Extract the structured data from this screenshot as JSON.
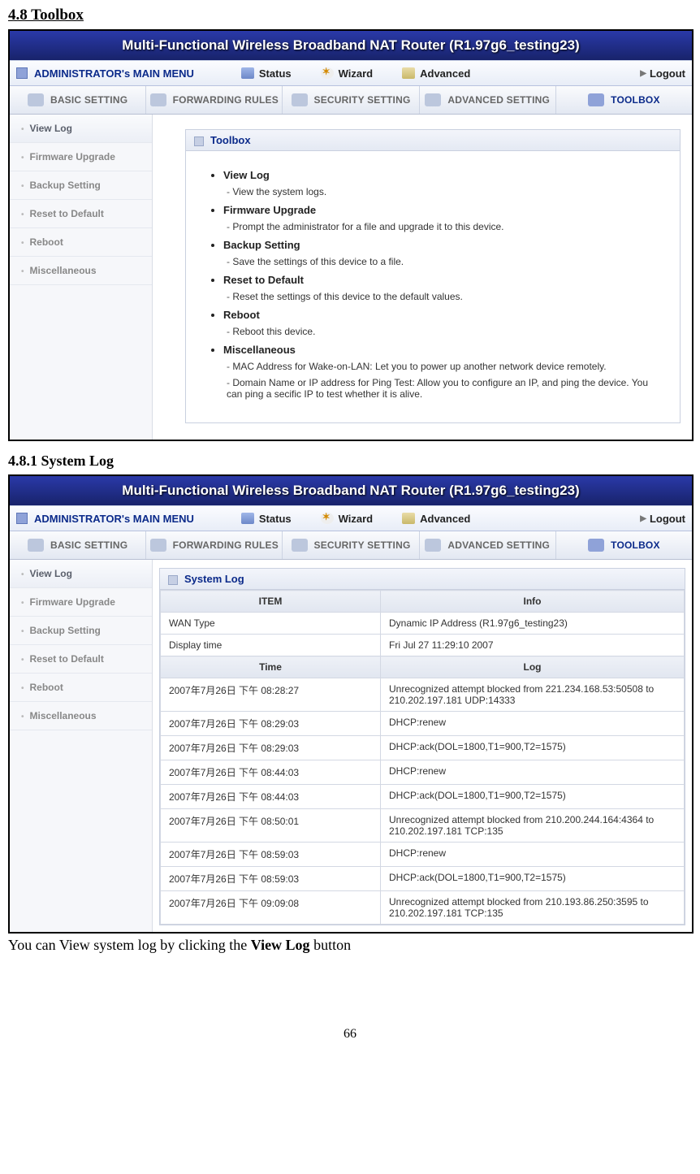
{
  "doc": {
    "section_heading": "4.8 Toolbox",
    "sub_heading": "4.8.1 System Log",
    "caption_pre": "You can View system log by clicking the ",
    "caption_bold": "View Log",
    "caption_post": " button",
    "page_number": "66"
  },
  "router": {
    "title": "Multi-Functional Wireless Broadband NAT Router (R1.97g6_testing23)",
    "main_menu_label": "ADMINISTRATOR's MAIN MENU",
    "menu": {
      "status": "Status",
      "wizard": "Wizard",
      "advanced": "Advanced",
      "logout": "Logout"
    },
    "tabs": {
      "basic": "BASIC SETTING",
      "forwarding": "FORWARDING RULES",
      "security": "SECURITY SETTING",
      "advanced": "ADVANCED SETTING",
      "toolbox": "TOOLBOX"
    },
    "sidebar": {
      "view_log": "View Log",
      "firmware": "Firmware Upgrade",
      "backup": "Backup Setting",
      "reset": "Reset to Default",
      "reboot": "Reboot",
      "misc": "Miscellaneous"
    }
  },
  "toolbox_panel": {
    "header": "Toolbox",
    "items": {
      "view_log": {
        "title": "View Log",
        "desc": "View the system logs."
      },
      "firmware": {
        "title": "Firmware Upgrade",
        "desc": "Prompt the administrator for a file and upgrade it to this device."
      },
      "backup": {
        "title": "Backup Setting",
        "desc": "Save the settings of this device to a file."
      },
      "reset": {
        "title": "Reset to Default",
        "desc": "Reset the settings of this device to the default values."
      },
      "reboot": {
        "title": "Reboot",
        "desc": "Reboot this device."
      },
      "misc": {
        "title": "Miscellaneous",
        "desc1": "MAC Address for Wake-on-LAN: Let you to power up another network device remotely.",
        "desc2": "Domain Name or IP address for Ping Test: Allow you to configure an IP, and ping the device. You can ping a secific IP to test whether it is alive."
      }
    }
  },
  "syslog_panel": {
    "header": "System Log",
    "cols": {
      "item": "ITEM",
      "info": "Info",
      "time": "Time",
      "log": "Log"
    },
    "info_rows": {
      "wan_type_l": "WAN Type",
      "wan_type_v": "Dynamic IP Address (R1.97g6_testing23)",
      "display_time_l": "Display time",
      "display_time_v": "Fri Jul 27 11:29:10 2007"
    },
    "rows": [
      {
        "time": "2007年7月26日 下午 08:28:27",
        "log": "Unrecognized attempt blocked from 221.234.168.53:50508 to 210.202.197.181 UDP:14333"
      },
      {
        "time": "2007年7月26日 下午 08:29:03",
        "log": "DHCP:renew"
      },
      {
        "time": "2007年7月26日 下午 08:29:03",
        "log": "DHCP:ack(DOL=1800,T1=900,T2=1575)"
      },
      {
        "time": "2007年7月26日 下午 08:44:03",
        "log": "DHCP:renew"
      },
      {
        "time": "2007年7月26日 下午 08:44:03",
        "log": "DHCP:ack(DOL=1800,T1=900,T2=1575)"
      },
      {
        "time": "2007年7月26日 下午 08:50:01",
        "log": "Unrecognized attempt blocked from 210.200.244.164:4364 to 210.202.197.181 TCP:135"
      },
      {
        "time": "2007年7月26日 下午 08:59:03",
        "log": "DHCP:renew"
      },
      {
        "time": "2007年7月26日 下午 08:59:03",
        "log": "DHCP:ack(DOL=1800,T1=900,T2=1575)"
      },
      {
        "time": "2007年7月26日 下午 09:09:08",
        "log": "Unrecognized attempt blocked from 210.193.86.250:3595 to 210.202.197.181 TCP:135"
      }
    ]
  }
}
